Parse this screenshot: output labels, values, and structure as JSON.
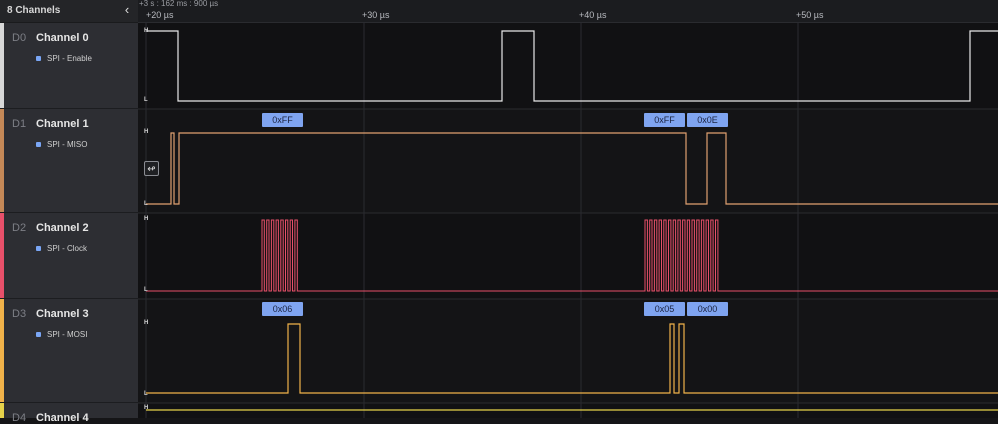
{
  "sidebar": {
    "title": "8 Channels",
    "channels": [
      {
        "id": "D0",
        "name": "Channel 0",
        "analyzer": "SPI - Enable",
        "color": "#d8d8d8"
      },
      {
        "id": "D1",
        "name": "Channel 1",
        "analyzer": "SPI - MISO",
        "color": "#c48857"
      },
      {
        "id": "D2",
        "name": "Channel 2",
        "analyzer": "SPI - Clock",
        "color": "#e8506a"
      },
      {
        "id": "D3",
        "name": "Channel 3",
        "analyzer": "SPI - MOSI",
        "color": "#f0b24a"
      },
      {
        "id": "D4",
        "name": "Channel 4",
        "analyzer": "",
        "color": "#e6d24a"
      }
    ]
  },
  "ruler": {
    "offset": "+3 s : 162 ms : 900 µs",
    "ticks": [
      "+20 µs",
      "+30 µs",
      "+40 µs",
      "+50 µs"
    ]
  },
  "annotations": {
    "miso": [
      "0xFF",
      "0xFF",
      "0x0E"
    ],
    "mosi": [
      "0x06",
      "0x05",
      "0x00"
    ]
  },
  "levels": {
    "high": "H",
    "low": "L"
  },
  "colors": {
    "ch0": "#e8e8e8",
    "ch1": "#e0a070",
    "ch2": "#e8506a",
    "ch3": "#f0b24a",
    "ch4": "#e6d24a",
    "annotation": "#7fa4f0"
  }
}
